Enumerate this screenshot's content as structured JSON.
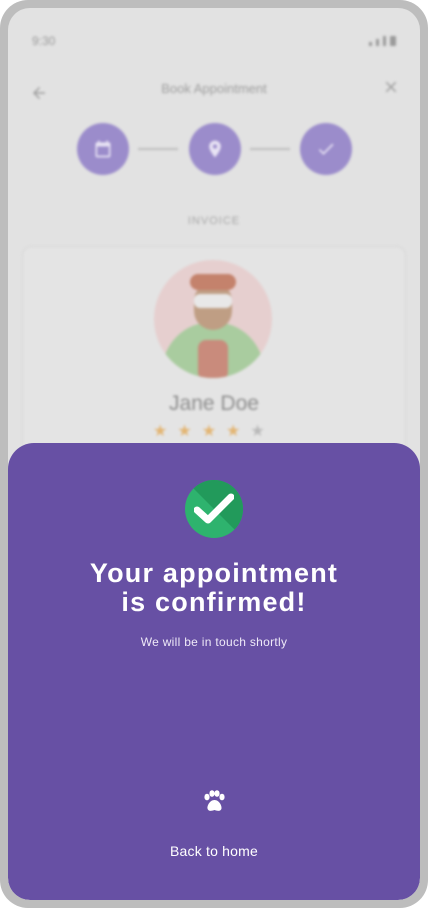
{
  "status_bar": {
    "time": "9:30"
  },
  "header": {
    "back_icon": "arrow-back-icon",
    "title": "Book Appointment",
    "close_icon": "close-icon"
  },
  "stepper": {
    "steps": [
      {
        "icon": "calendar-icon"
      },
      {
        "icon": "location-pin-icon"
      },
      {
        "icon": "check-icon"
      }
    ],
    "section_label": "INVOICE"
  },
  "groomer": {
    "name": "Jane Doe",
    "rating": 4,
    "rating_max": 5
  },
  "confirmation": {
    "icon": "checkmark-circle-icon",
    "title_line1": "Your appointment",
    "title_line2": "is confirmed!",
    "subtitle": "We will be in touch shortly",
    "paw_icon": "paw-icon",
    "back_home_label": "Back to home"
  },
  "colors": {
    "primary": "#6750a4",
    "success": "#2eb36e",
    "star": "#e3b573",
    "step_fill": "#9b8ccb"
  }
}
